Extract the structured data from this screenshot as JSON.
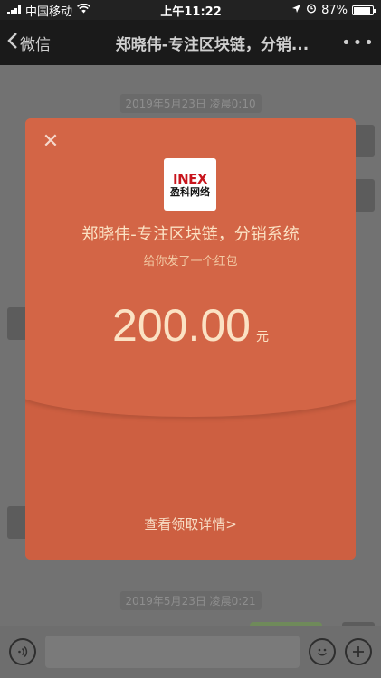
{
  "status_bar": {
    "carrier": "中国移动",
    "time": "上午11:22",
    "battery": "87%",
    "battery_level": 0.87
  },
  "nav": {
    "back_label": "微信",
    "title": "郑晓伟-专注区块链，分销...",
    "more_label": "•••"
  },
  "chat": {
    "timestamps": [
      "2019年5月23日 凌晨0:10",
      "2019年5月23日 凌晨0:21"
    ]
  },
  "packet": {
    "close_symbol": "✕",
    "logo_text": "INEX",
    "logo_subtext": "盈科网络",
    "sender": "郑晓伟-专注区块链，分销系统",
    "greeting": "给你发了一个红包",
    "amount": "200.00",
    "currency": "元",
    "detail_link": "查看领取详情>"
  },
  "icons": [
    "wifi-icon",
    "location-icon",
    "alarm-icon",
    "back-chevron-icon",
    "voice-icon",
    "emoji-icon",
    "plus-icon"
  ]
}
